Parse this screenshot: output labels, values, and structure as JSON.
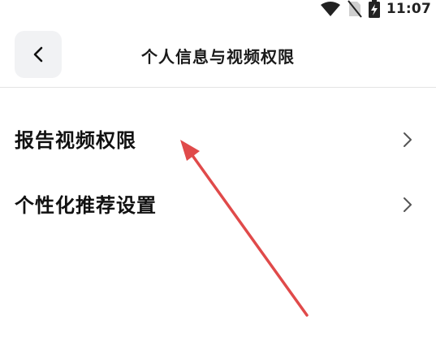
{
  "status_bar": {
    "time": "11:07",
    "icons": [
      "wifi-icon",
      "no-sim-icon",
      "battery-charging-icon"
    ]
  },
  "header": {
    "back_icon": "chevron-left-icon",
    "title": "个人信息与视频权限"
  },
  "menu": {
    "items": [
      {
        "label": "报告视频权限",
        "icon": "chevron-right-icon"
      },
      {
        "label": "个性化推荐设置",
        "icon": "chevron-right-icon"
      }
    ]
  },
  "annotation": {
    "arrow_color": "#e04a4a"
  },
  "colors": {
    "background": "#ffffff",
    "back_button_bg": "#f1f2f4",
    "text_primary": "#111111",
    "chevron": "#555555",
    "divider": "#e3e3e3"
  }
}
